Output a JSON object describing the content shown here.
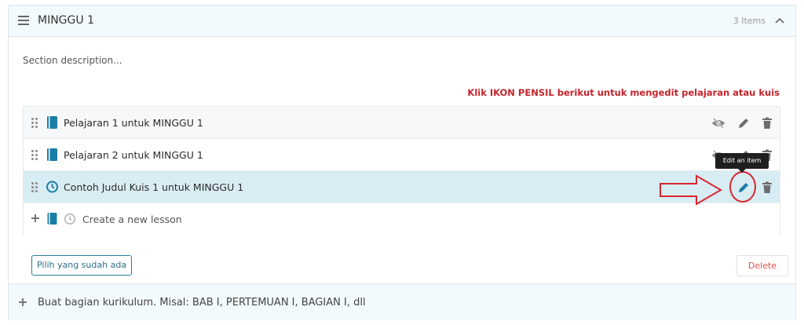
{
  "section": {
    "title": "MINGGU 1",
    "item_count": "3 Items",
    "description": "Section description...",
    "hint": "Klik IKON PENSIL berikut untuk mengedit pelajaran atau kuis"
  },
  "items": [
    {
      "title": "Pelajaran 1 untuk MINGGU 1",
      "type": "lesson"
    },
    {
      "title": "Pelajaran 2 untuk MINGGU 1",
      "type": "lesson"
    },
    {
      "title": "Contoh Judul Kuis 1 untuk MINGGU 1",
      "type": "quiz"
    }
  ],
  "new_item": {
    "placeholder": "Create a new lesson"
  },
  "tooltip": "Edit an item",
  "buttons": {
    "select_existing": "Pilih yang sudah ada",
    "delete": "Delete"
  },
  "footer": {
    "text": "Buat bagian kurikulum. Misal: BAB I, PERTEMUAN I, BAGIAN I, dll"
  },
  "colors": {
    "accent": "#1a7ea6",
    "highlight": "#d8ecf3",
    "hint": "#c4242b",
    "annotation": "#d8262f"
  },
  "icons": [
    "hamburger-icon",
    "chevron-up-icon",
    "drag-handle-icon",
    "book-icon",
    "clock-icon",
    "eye-slash-icon",
    "pencil-icon",
    "trash-icon",
    "plus-icon"
  ]
}
